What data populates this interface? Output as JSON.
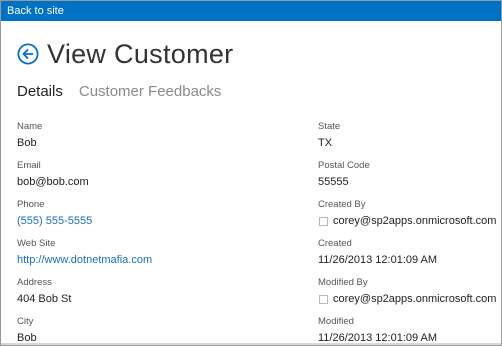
{
  "topbar": {
    "back_to_site": "Back to site"
  },
  "header": {
    "title": "View Customer"
  },
  "tabs": [
    {
      "label": "Details",
      "active": true
    },
    {
      "label": "Customer Feedbacks",
      "active": false
    }
  ],
  "left_fields": [
    {
      "label": "Name",
      "value": "Bob"
    },
    {
      "label": "Email",
      "value": "bob@bob.com"
    },
    {
      "label": "Phone",
      "value": "(555) 555-5555"
    },
    {
      "label": "Web Site",
      "value": "http://www.dotnetmafia.com"
    },
    {
      "label": "Address",
      "value": "404 Bob St"
    },
    {
      "label": "City",
      "value": "Bob"
    }
  ],
  "right_fields": [
    {
      "label": "State",
      "value": "TX"
    },
    {
      "label": "Postal Code",
      "value": "55555"
    },
    {
      "label": "Created By",
      "value": "corey@sp2apps.onmicrosoft.com"
    },
    {
      "label": "Created",
      "value": "11/26/2013 12:01:09 AM"
    },
    {
      "label": "Modified By",
      "value": "corey@sp2apps.onmicrosoft.com"
    },
    {
      "label": "Modified",
      "value": "11/26/2013 12:01:09 AM"
    }
  ],
  "icons": {
    "back": "back-arrow-circle-icon",
    "presence": "presence-indicator-icon"
  },
  "colors": {
    "topbar": "#0072c6",
    "link": "#1a6fbb",
    "accent": "#0072c6"
  }
}
